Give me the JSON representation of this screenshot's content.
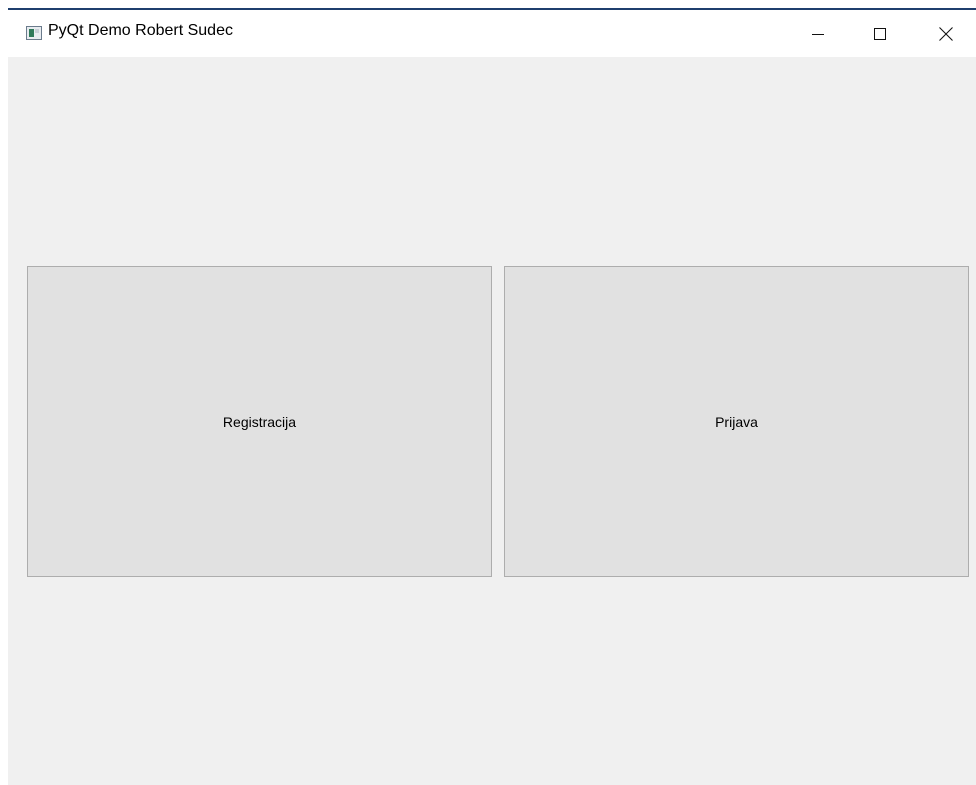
{
  "window": {
    "title": "PyQt Demo Robert Sudec",
    "icon": "app-window-icon",
    "controls": {
      "minimize_icon": "minimize-icon",
      "maximize_icon": "maximize-icon",
      "close_icon": "close-icon"
    }
  },
  "main": {
    "buttons": [
      {
        "label": "Registracija"
      },
      {
        "label": "Prijava"
      }
    ]
  },
  "colors": {
    "window_background": "#f0f0f0",
    "button_background": "#e1e1e1",
    "button_border": "#adadad",
    "titlebar_background": "#ffffff",
    "window_border_accent": "#1f3f6e"
  }
}
